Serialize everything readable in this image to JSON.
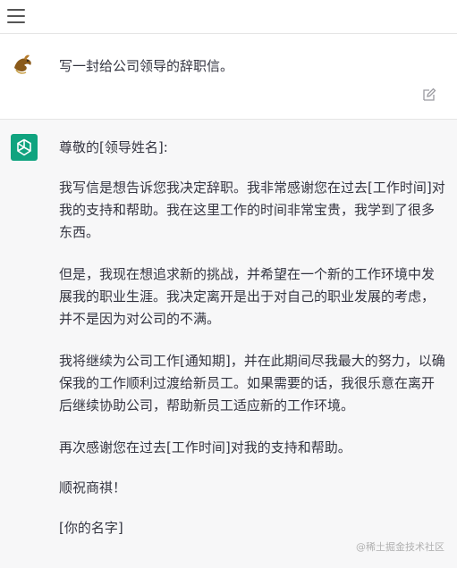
{
  "user": {
    "prompt": "写一封给公司领导的辞职信。"
  },
  "assistant": {
    "greeting": "尊敬的[领导姓名]:",
    "paragraphs": [
      "我写信是想告诉您我决定辞职。我非常感谢您在过去[工作时间]对我的支持和帮助。我在这里工作的时间非常宝贵，我学到了很多东西。",
      "但是，我现在想追求新的挑战，并希望在一个新的工作环境中发展我的职业生涯。我决定离开是出于对自己的职业发展的考虑，并不是因为对公司的不满。",
      "我将继续为公司工作[通知期]，并在此期间尽我最大的努力，以确保我的工作顺利过渡给新员工。如果需要的话，我很乐意在离开后继续协助公司，帮助新员工适应新的工作环境。",
      "再次感谢您在过去[工作时间]对我的支持和帮助。"
    ],
    "closing": "顺祝商祺！",
    "signature": "[你的名字]"
  },
  "watermark": "@稀土掘金技术社区",
  "colors": {
    "assistant_avatar_bg": "#10a37f",
    "assistant_bg": "#f7f7f8"
  }
}
